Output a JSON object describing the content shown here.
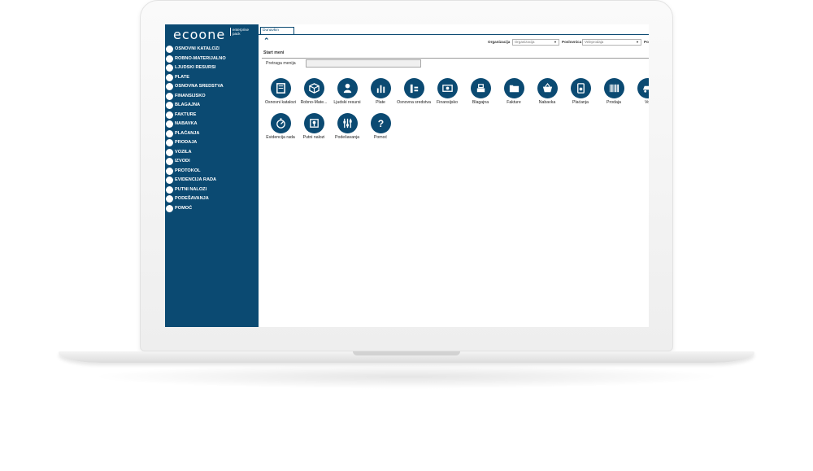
{
  "brand": {
    "logo_text": "ecoone",
    "logo_sub_1": "enterprise",
    "logo_sub_2": "pack"
  },
  "sidebar": {
    "items": [
      {
        "label": "OSNOVNI KATALOZI",
        "icon": "catalog-icon"
      },
      {
        "label": "ROBNO-MATERIJALNO",
        "icon": "box-icon"
      },
      {
        "label": "LJUDSKI RESURSI",
        "icon": "person-icon"
      },
      {
        "label": "PLATE",
        "icon": "bar-chart-icon"
      },
      {
        "label": "OSNOVNA SREDSTVA",
        "icon": "assets-icon"
      },
      {
        "label": "FINANSIJSKO",
        "icon": "money-icon"
      },
      {
        "label": "BLAGAJNA",
        "icon": "cash-register-icon"
      },
      {
        "label": "FAKTURE",
        "icon": "folder-icon"
      },
      {
        "label": "NABAVKA",
        "icon": "basket-icon"
      },
      {
        "label": "PLAĆANJA",
        "icon": "card-icon"
      },
      {
        "label": "PRODAJA",
        "icon": "barcode-icon"
      },
      {
        "label": "VOZILA",
        "icon": "car-icon"
      },
      {
        "label": "IZVODI",
        "icon": "statement-icon"
      },
      {
        "label": "PROTOKOL",
        "icon": "protocol-icon"
      },
      {
        "label": "EVIDENCIJA RADA",
        "icon": "stopwatch-icon"
      },
      {
        "label": "PUTNI NALOZI",
        "icon": "map-icon"
      },
      {
        "label": "PODEŠAVANJA",
        "icon": "settings-icon"
      },
      {
        "label": "POMOĆ",
        "icon": "help-icon"
      }
    ]
  },
  "tabs": [
    {
      "label": "Dunavkin"
    }
  ],
  "filters": {
    "org_label": "Organizacija",
    "org_value": "Organizacija",
    "unit_label": "Poslovnica",
    "unit_value": "Veleprodaja",
    "extra_label": "Po"
  },
  "section": {
    "title": "Start meni",
    "search_label": "Pretraga menija"
  },
  "tiles": [
    {
      "label": "Osnovni katalozi",
      "icon": "catalog-icon"
    },
    {
      "label": "Robno-Mate...",
      "icon": "box-icon"
    },
    {
      "label": "Ljudski resursi",
      "icon": "person-icon"
    },
    {
      "label": "Plate",
      "icon": "bar-chart-icon"
    },
    {
      "label": "Osnovna sredstva",
      "icon": "assets-icon"
    },
    {
      "label": "Finansijsko",
      "icon": "money-icon"
    },
    {
      "label": "Blagajna",
      "icon": "cash-register-icon"
    },
    {
      "label": "Fakture",
      "icon": "folder-icon"
    },
    {
      "label": "Nabavka",
      "icon": "basket-icon"
    },
    {
      "label": "Plaćanja",
      "icon": "card-icon"
    },
    {
      "label": "Prodaja",
      "icon": "barcode-icon"
    },
    {
      "label": "Vo",
      "icon": "car-icon"
    },
    {
      "label": "Evidencija rada",
      "icon": "stopwatch-icon"
    },
    {
      "label": "Putni nalozi",
      "icon": "map-icon"
    },
    {
      "label": "Podešavanja",
      "icon": "settings-icon"
    },
    {
      "label": "Pomoć",
      "icon": "help-icon"
    }
  ],
  "colors": {
    "brand": "#0b4a72",
    "frame": "#eeeeee"
  }
}
